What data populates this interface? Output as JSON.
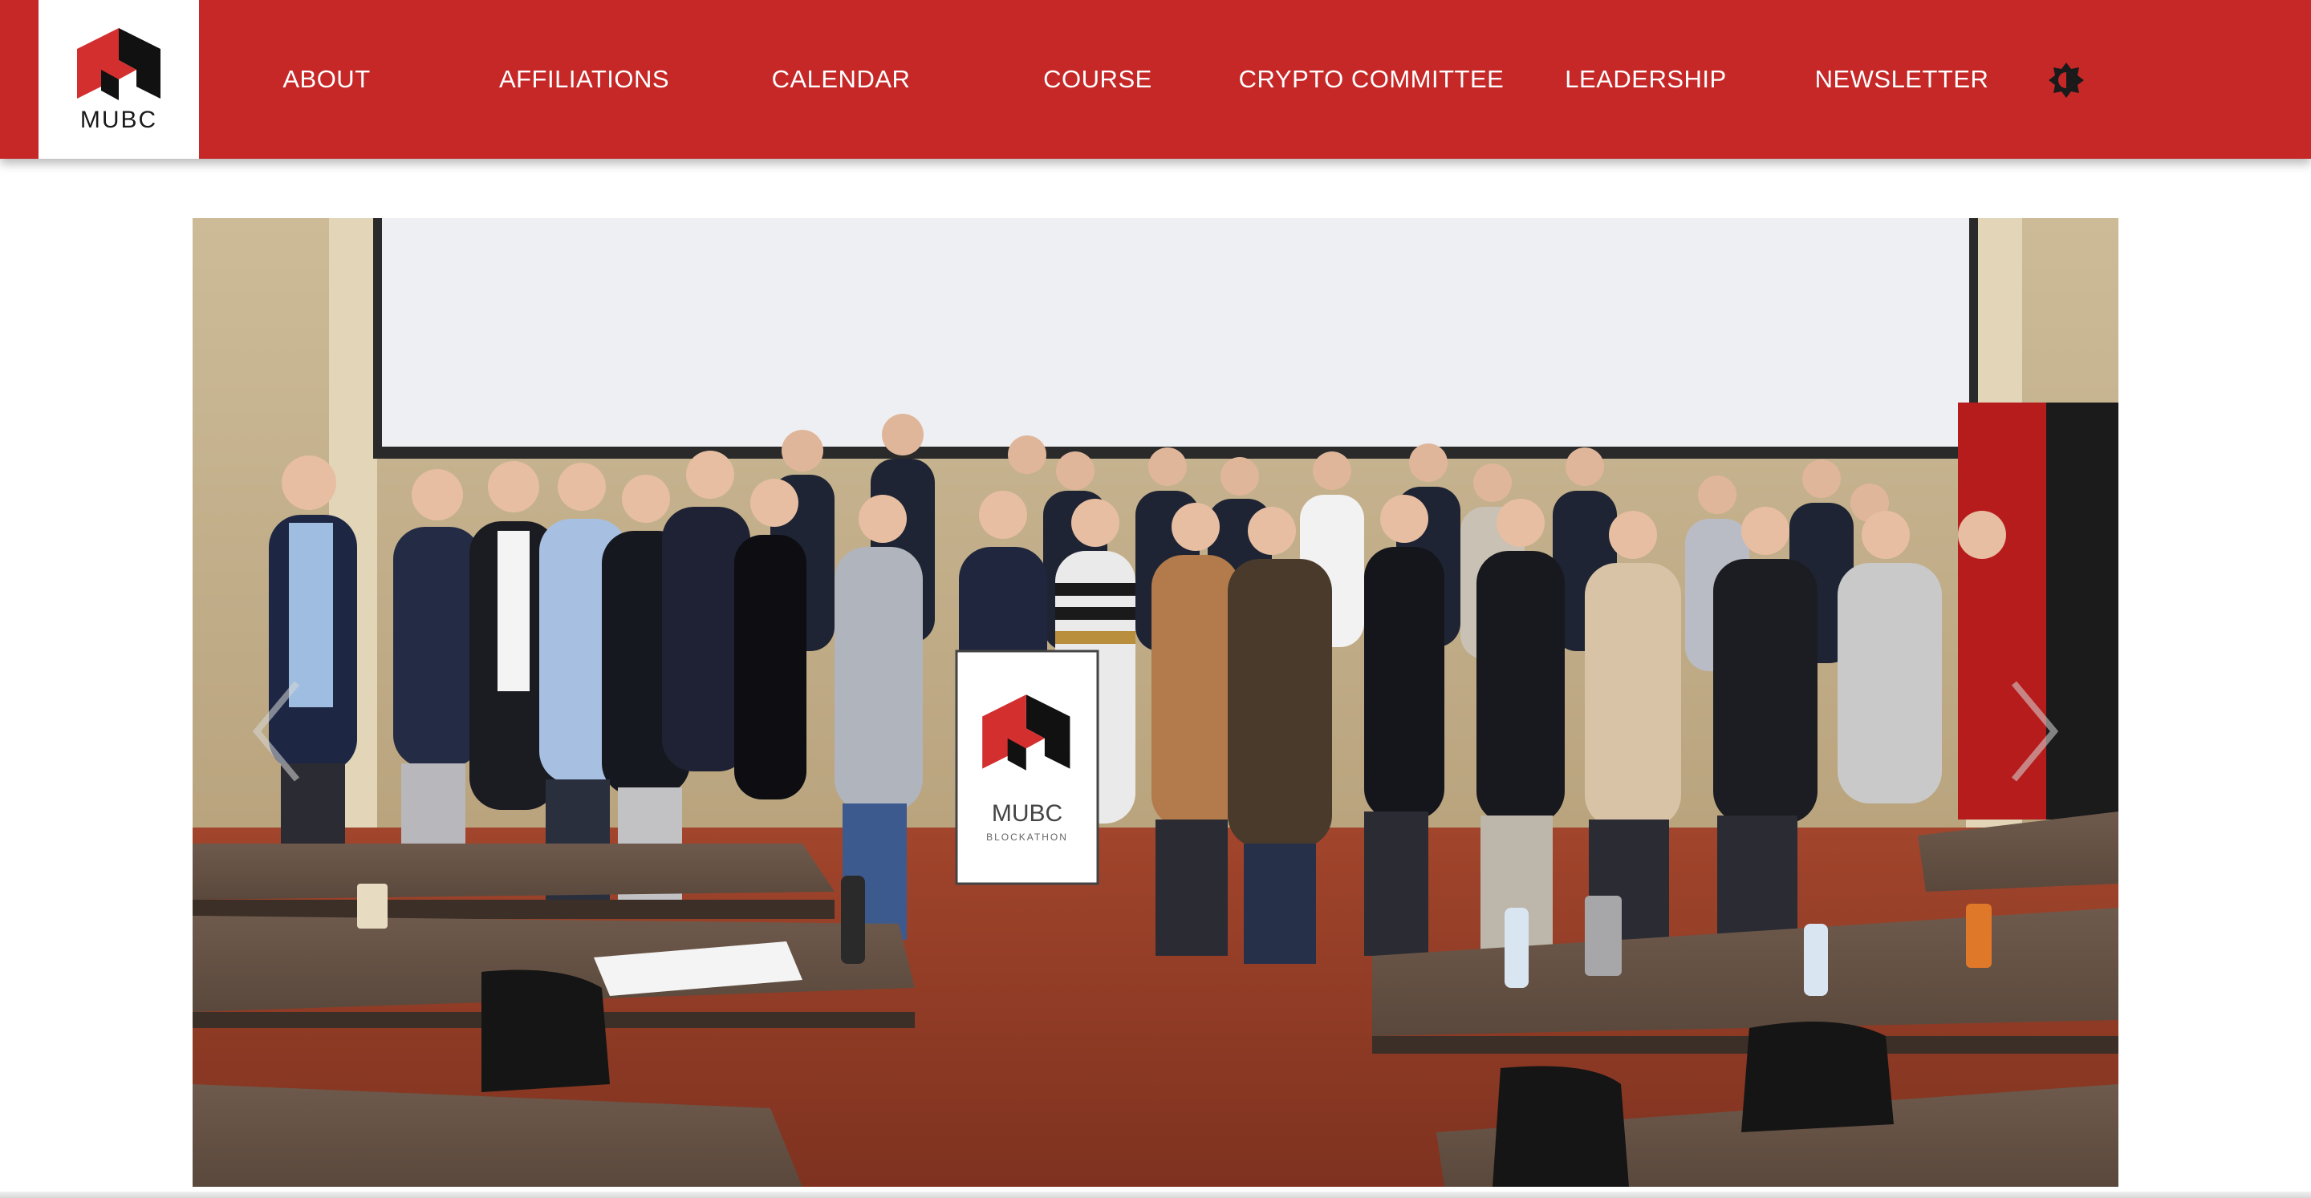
{
  "brand": {
    "name": "MUBC",
    "colors": {
      "primary": "#c62828",
      "logo_red": "#d32f2f",
      "logo_black": "#111111"
    }
  },
  "nav": {
    "items": [
      {
        "label": "ABOUT"
      },
      {
        "label": "AFFILIATIONS"
      },
      {
        "label": "CALENDAR"
      },
      {
        "label": "COURSE"
      },
      {
        "label": "CRYPTO COMMITTEE"
      },
      {
        "label": "LEADERSHIP"
      },
      {
        "label": "NEWSLETTER"
      }
    ],
    "theme_toggle_icon": "brightness-icon"
  },
  "hero": {
    "banner_text": "MUBC",
    "banner_subtext": "BLOCKATHON",
    "prev_icon": "chevron-left-icon",
    "next_icon": "chevron-right-icon"
  }
}
